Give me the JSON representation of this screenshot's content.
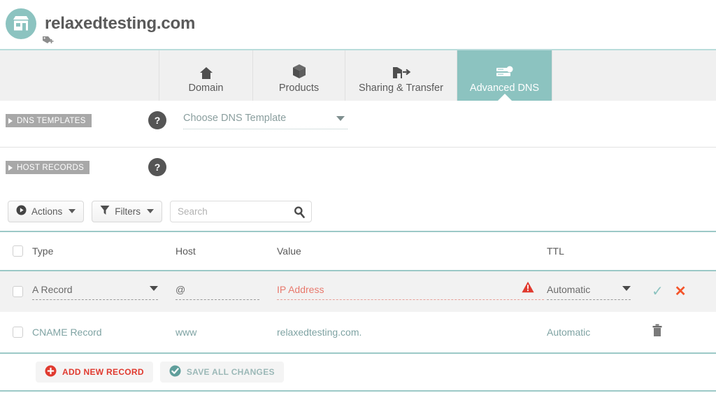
{
  "header": {
    "domain_title": "relaxedtesting.com",
    "logo_icon": "storefront-icon",
    "tag_icon": "tag-plus-icon"
  },
  "tabs": [
    {
      "id": "domain",
      "label": "Domain",
      "icon": "home-icon",
      "active": false
    },
    {
      "id": "products",
      "label": "Products",
      "icon": "box-icon",
      "active": false
    },
    {
      "id": "sharing",
      "label": "Sharing & Transfer",
      "icon": "transfer-icon",
      "active": false
    },
    {
      "id": "dns",
      "label": "Advanced DNS",
      "icon": "server-icon",
      "active": true
    }
  ],
  "sections": {
    "dns_templates": {
      "ribbon_label": "DNS TEMPLATES",
      "help_label": "?",
      "select_value": "Choose DNS Template"
    },
    "host_records": {
      "ribbon_label": "HOST RECORDS",
      "help_label": "?"
    }
  },
  "toolbar": {
    "actions_label": "Actions",
    "filters_label": "Filters",
    "search_value": "",
    "search_placeholder": "Search"
  },
  "table": {
    "columns": [
      "Type",
      "Host",
      "Value",
      "TTL"
    ],
    "rows": [
      {
        "mode": "editing",
        "type": "A Record",
        "host": "@",
        "value_placeholder": "IP Address",
        "value": "",
        "ttl": "Automatic",
        "has_warning": true,
        "confirm_icon": "check-icon",
        "cancel_icon": "close-icon"
      },
      {
        "mode": "saved",
        "type": "CNAME Record",
        "host": "www",
        "value": "relaxedtesting.com.",
        "ttl": "Automatic",
        "delete_icon": "trash-icon"
      }
    ]
  },
  "footer": {
    "add_label": "ADD NEW RECORD",
    "save_label": "SAVE ALL CHANGES",
    "add_icon": "plus-circle-icon",
    "save_icon": "check-circle-icon"
  },
  "colors": {
    "teal": "#8cc3c0",
    "teal_rule": "#9cc9c7",
    "red": "#e03a2f",
    "orange": "#f4542a",
    "salmon": "#e8796d",
    "gray_text": "#5a5a5a",
    "ribbon_gray": "#a8a8a8",
    "row_edit_bg": "#f2f2f2"
  }
}
